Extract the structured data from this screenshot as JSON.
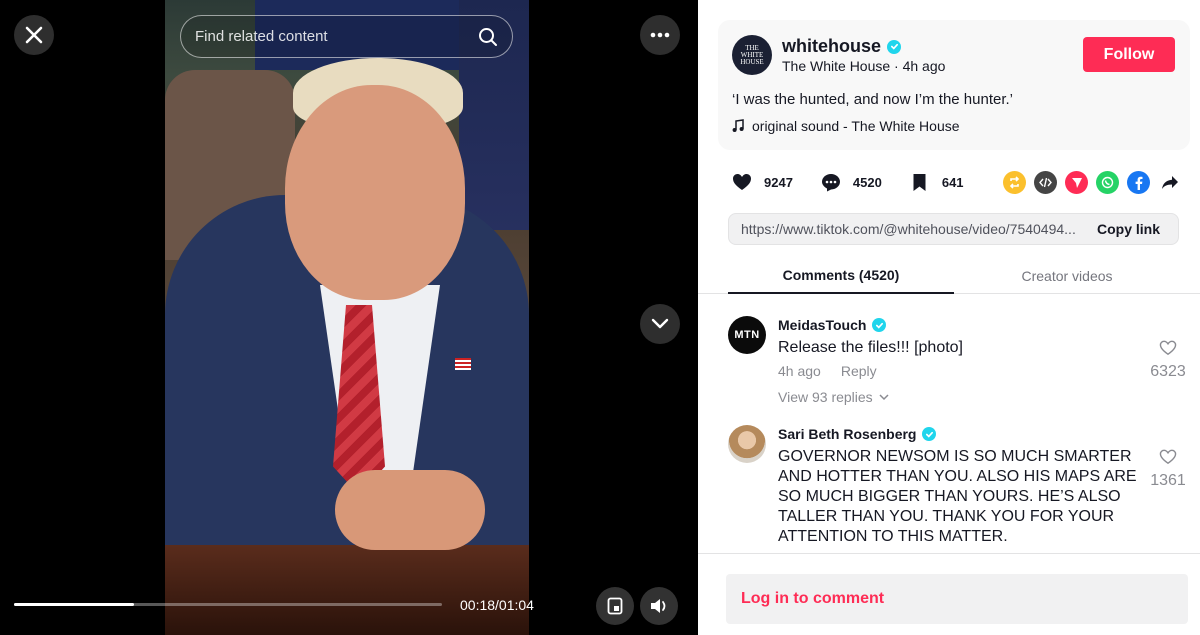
{
  "video": {
    "search_placeholder": "Find related content",
    "time": "00:18/01:04",
    "progress_fraction": 0.28
  },
  "post": {
    "username": "whitehouse",
    "display_name": "The White House",
    "age": "4h ago",
    "subline": "The White House · 4h ago",
    "follow_label": "Follow",
    "caption": "‘I was the hunted, and now I’m the hunter.’",
    "sound": "original sound - The White House",
    "avatar_text": "THE WHITE HOUSE"
  },
  "stats": {
    "likes": "9247",
    "comments": "4520",
    "saves": "641"
  },
  "share": {
    "icons": [
      "repost-icon",
      "embed-icon",
      "send-icon",
      "whatsapp-icon",
      "facebook-icon",
      "share-arrow-icon"
    ],
    "colors": [
      "#fbc02d",
      "#454545",
      "#fe2c55",
      "#25d366",
      "#1877f2",
      "#161823"
    ]
  },
  "link": {
    "url": "https://www.tiktok.com/@whitehouse/video/7540494...",
    "copy_label": "Copy link"
  },
  "tabs": [
    {
      "label": "Comments (4520)",
      "active": true
    },
    {
      "label": "Creator videos",
      "active": false
    }
  ],
  "comments": [
    {
      "name": "MeidasTouch",
      "avatar_text": "MTN",
      "text": "Release the files!!! [photo]",
      "age": "4h ago",
      "reply_label": "Reply",
      "view_replies": "View 93 replies",
      "likes": "6323"
    },
    {
      "name": "Sari Beth Rosenberg",
      "text": "GOVERNOR NEWSOM IS SO MUCH SMARTER AND HOTTER THAN YOU. ALSO HIS MAPS ARE SO MUCH BIGGER THAN YOURS. HE’S ALSO TALLER THAN YOU. THANK YOU FOR YOUR ATTENTION TO THIS MATTER.",
      "likes": "1361"
    }
  ],
  "login": {
    "label": "Log in to comment"
  },
  "colors": {
    "accent": "#fe2c55",
    "verified": "#20d5ec"
  }
}
